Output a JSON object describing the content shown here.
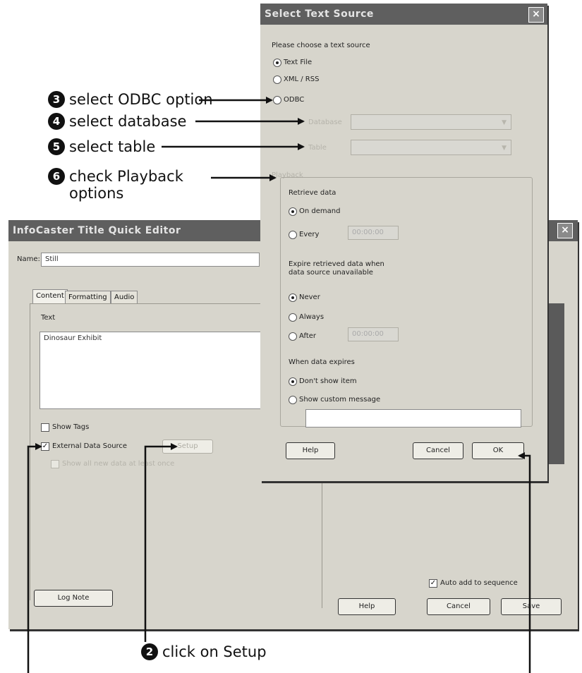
{
  "callouts": {
    "c2": {
      "num": "2",
      "text": "click on Setup"
    },
    "c3": {
      "num": "3",
      "text": "select ODBC option"
    },
    "c4": {
      "num": "4",
      "text": "select database"
    },
    "c5": {
      "num": "5",
      "text": "select table"
    },
    "c6": {
      "num": "6",
      "line1": "check Playback",
      "line2": "options"
    }
  },
  "editor": {
    "title": "InfoCaster Title Quick Editor",
    "close": "×",
    "name_label": "Name:",
    "name_value": "Still",
    "tabs": [
      "Content",
      "Formatting",
      "Audio"
    ],
    "text_label": "Text",
    "text_value": "Dinosaur Exhibit",
    "show_tags": "Show Tags",
    "external_data_source": "External Data Source",
    "setup": "Setup",
    "show_all": "Show all new data at least once",
    "log_note": "Log Note",
    "help": "Help",
    "cancel": "Cancel",
    "save": "Save",
    "auto_add": "Auto add to sequence"
  },
  "source_dialog": {
    "title": "Select Text Source",
    "close": "×",
    "prompt": "Please choose a text source",
    "options": {
      "text_file": "Text File",
      "rss": "XML / RSS",
      "odbc": "ODBC"
    },
    "database_label": "Database",
    "table_label": "Table",
    "playback_label": "Playback",
    "retrieve_label": "Retrieve data",
    "on_demand": "On demand",
    "every": "Every",
    "every_value": "00:00:00",
    "expire_label_1": "Expire retrieved data when",
    "expire_label_2": "data source unavailable",
    "never": "Never",
    "always": "Always",
    "after": "After",
    "after_value": "00:00:00",
    "when_expires": "When data expires",
    "dont_show": "Don't show item",
    "custom_message": "Show custom message",
    "help": "Help",
    "cancel": "Cancel",
    "ok": "OK"
  }
}
